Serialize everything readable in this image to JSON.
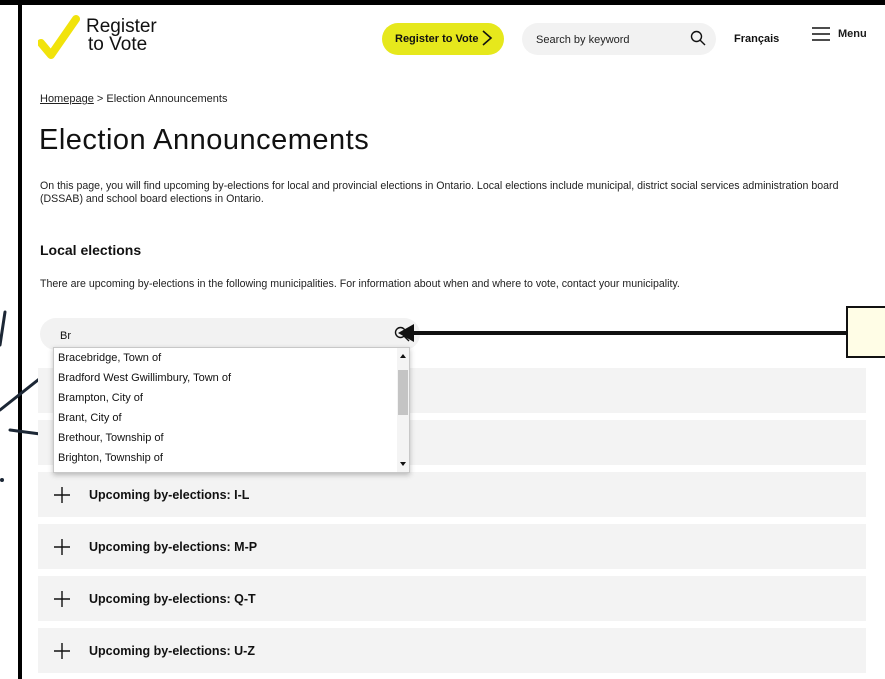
{
  "header": {
    "logo_line1": "Register",
    "logo_line2": "to Vote",
    "register_button": "Register to Vote",
    "search_placeholder": "Search by keyword",
    "language_link": "Français",
    "menu_label": "Menu"
  },
  "breadcrumb": {
    "home": "Homepage",
    "separator": " > ",
    "current": "Election Announcements"
  },
  "page": {
    "title": "Election Announcements",
    "intro": "On this page, you will find upcoming by-elections for local and provincial elections in Ontario. Local elections include municipal, district social services administration board (DSSAB) and school board elections in Ontario.",
    "section_title": "Local elections",
    "section_desc": "There are upcoming by-elections in the following municipalities. For information about when and where to vote, contact your municipality."
  },
  "municipality_search": {
    "value": "Br",
    "suggestions": [
      "Bracebridge, Town of",
      "Bradford West Gwillimbury, Town of",
      "Brampton, City of",
      "Brant, City of",
      "Brethour, Township of",
      "Brighton, Township of"
    ]
  },
  "accordions": [
    {
      "label": "Upcoming  by-elections: I-L"
    },
    {
      "label": "Upcoming  by-elections: M-P"
    },
    {
      "label": "Upcoming  by-elections: Q-T"
    },
    {
      "label": "Upcoming  by-elections: U-Z"
    }
  ],
  "colors": {
    "accent_yellow": "#e6e81c",
    "logo_check": "#f1e30b",
    "panel_gray": "#f3f3f3",
    "annotation_fill": "#fffde6"
  },
  "icons": {
    "logo": "checkmark-icon",
    "register": "chevron-right-icon",
    "search": "search-icon",
    "menu": "hamburger-icon",
    "accordion": "plus-icon"
  }
}
